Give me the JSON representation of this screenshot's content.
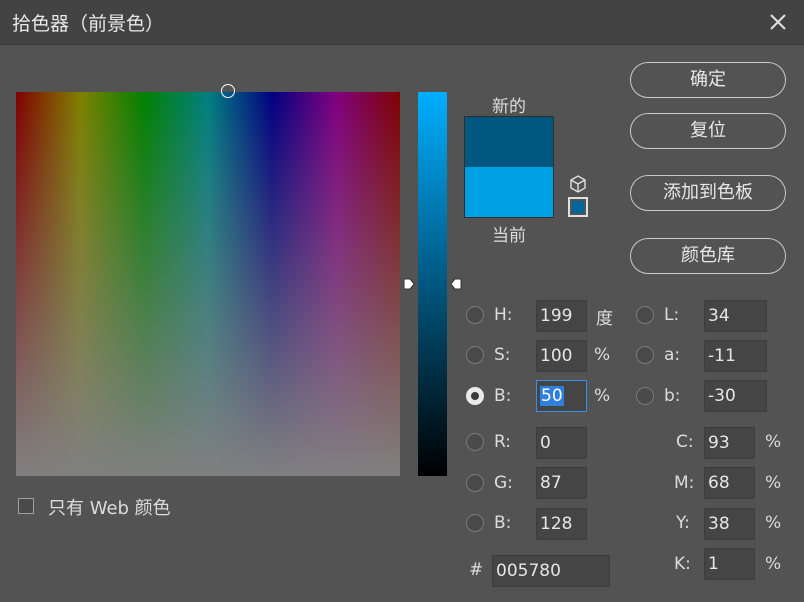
{
  "window": {
    "title": "拾色器（前景色）"
  },
  "icons": {
    "close": "close-icon",
    "cube": "cube-icon",
    "websafe": "websafe-swatch-icon"
  },
  "preview": {
    "new_label": "新的",
    "current_label": "当前",
    "new_color": "#005780",
    "current_color": "#00a0e6",
    "websafe_color": "#006699"
  },
  "buttons": {
    "ok": "确定",
    "reset": "复位",
    "add_swatch": "添加到色板",
    "libraries": "颜色库"
  },
  "hsb": {
    "h": {
      "label": "H:",
      "value": "199",
      "unit": "度"
    },
    "s": {
      "label": "S:",
      "value": "100",
      "unit": "%"
    },
    "b": {
      "label": "B:",
      "value": "50",
      "unit": "%"
    }
  },
  "rgb": {
    "r": {
      "label": "R:",
      "value": "0"
    },
    "g": {
      "label": "G:",
      "value": "87"
    },
    "b": {
      "label": "B:",
      "value": "128"
    }
  },
  "lab": {
    "l": {
      "label": "L:",
      "value": "34"
    },
    "a": {
      "label": "a:",
      "value": "-11"
    },
    "b": {
      "label": "b:",
      "value": "-30"
    }
  },
  "cmyk": {
    "c": {
      "label": "C:",
      "value": "93",
      "unit": "%"
    },
    "m": {
      "label": "M:",
      "value": "68",
      "unit": "%"
    },
    "y": {
      "label": "Y:",
      "value": "38",
      "unit": "%"
    },
    "k": {
      "label": "K:",
      "value": "1",
      "unit": "%"
    }
  },
  "hex": {
    "label": "#",
    "value": "005780"
  },
  "web_only": {
    "label": "只有 Web 颜色",
    "checked": false
  },
  "selected_mode": "B"
}
